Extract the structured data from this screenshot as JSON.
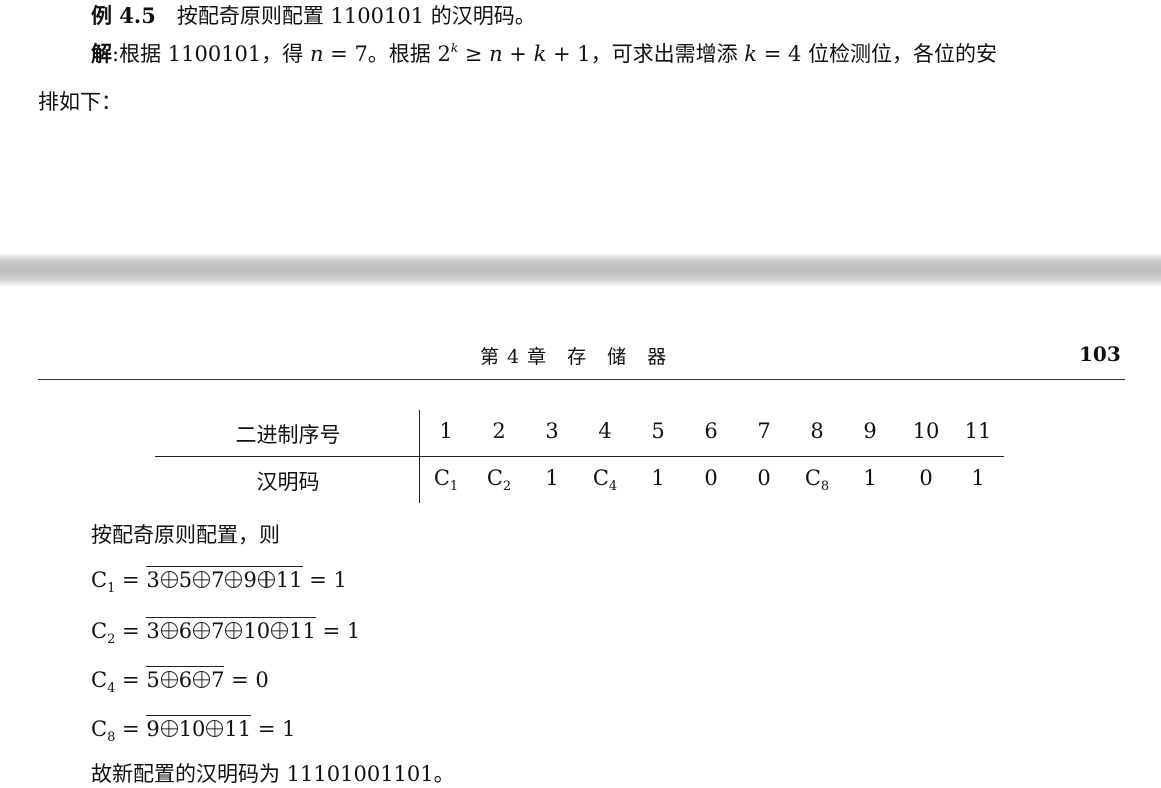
{
  "example": {
    "label": "例 4.5",
    "text": "按配奇原则配置 1100101 的汉明码。"
  },
  "solution": {
    "label": "解",
    "sep": ":",
    "p1": "根据 1100101，得 ",
    "n_var": "n",
    "p2": " = 7。根据 2",
    "k_sup": "k",
    "p3": " ≥ ",
    "p4": "n",
    "p5": " + ",
    "p6": "k",
    "p7": " + 1，可求出需增添 ",
    "p8": "k",
    "p9": " = 4 位检测位，各位的安",
    "line2": "排如下："
  },
  "header": {
    "chapter": "第 4 章　存　储　器",
    "page_number": "103"
  },
  "table": {
    "row1_label": "二进制序号",
    "row2_label": "汉明码",
    "positions": [
      "1",
      "2",
      "3",
      "4",
      "5",
      "6",
      "7",
      "8",
      "9",
      "10",
      "11"
    ],
    "code": [
      {
        "main": "C",
        "sub": "1"
      },
      {
        "main": "C",
        "sub": "2"
      },
      {
        "main": "1",
        "sub": ""
      },
      {
        "main": "C",
        "sub": "4"
      },
      {
        "main": "1",
        "sub": ""
      },
      {
        "main": "0",
        "sub": ""
      },
      {
        "main": "0",
        "sub": ""
      },
      {
        "main": "C",
        "sub": "8"
      },
      {
        "main": "1",
        "sub": ""
      },
      {
        "main": "0",
        "sub": ""
      },
      {
        "main": "1",
        "sub": ""
      }
    ]
  },
  "body": {
    "intro": "按配奇原则配置，则",
    "conclusion": "故新配置的汉明码为 11101001101。"
  },
  "equations": [
    {
      "lhs_main": "C",
      "lhs_sub": "1",
      "eq": " = ",
      "terms": [
        "3",
        "5",
        "7",
        "9",
        "11"
      ],
      "result": " = 1"
    },
    {
      "lhs_main": "C",
      "lhs_sub": "2",
      "eq": " = ",
      "terms": [
        "3",
        "6",
        "7",
        "10",
        "11"
      ],
      "result": " = 1"
    },
    {
      "lhs_main": "C",
      "lhs_sub": "4",
      "eq": " = ",
      "terms": [
        "5",
        "6",
        "7"
      ],
      "result": " = 0"
    },
    {
      "lhs_main": "C",
      "lhs_sub": "8",
      "eq": " = ",
      "terms": [
        "9",
        "10",
        "11"
      ],
      "result": " = 1"
    }
  ]
}
